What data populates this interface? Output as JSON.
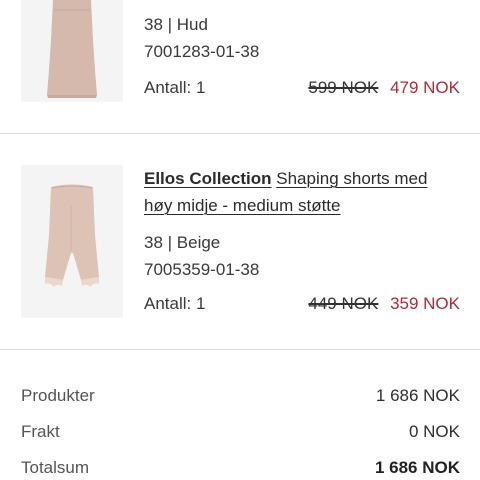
{
  "cart": {
    "items": [
      {
        "brand": "",
        "title": "",
        "variant": "38 | Hud",
        "sku": "7001283-01-38",
        "quantity": "Antall: 1",
        "old_price": "599 NOK",
        "new_price": "479 NOK",
        "image_icon": "shapewear-dress-product-image"
      },
      {
        "brand": "Ellos Collection",
        "title": "Shaping shorts med høy midje - medium støtte",
        "variant": "38 | Beige",
        "sku": "7005359-01-38",
        "quantity": "Antall: 1",
        "old_price": "449 NOK",
        "new_price": "359 NOK",
        "image_icon": "shaping-shorts-product-image"
      }
    ]
  },
  "summary": {
    "products_label": "Produkter",
    "products_value": "1 686 NOK",
    "shipping_label": "Frakt",
    "shipping_value": "0 NOK",
    "total_label": "Totalsum",
    "total_value": "1 686 NOK"
  },
  "colors": {
    "sale_price": "#b3273b",
    "divider": "#dddddd",
    "thumb_background": "#f4f4f4",
    "product_skin": "#d8bfb2"
  }
}
